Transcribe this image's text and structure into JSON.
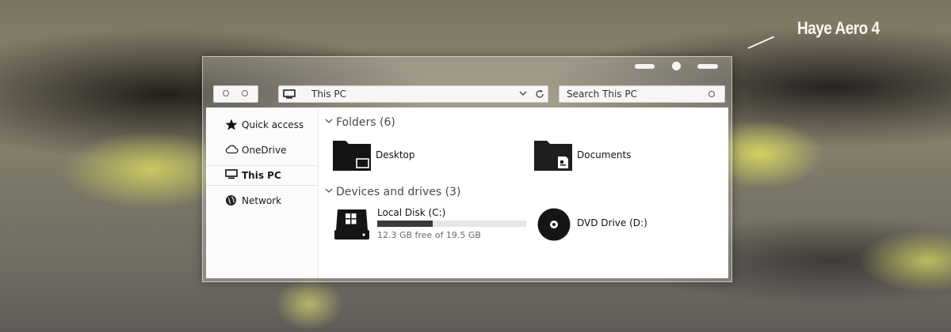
{
  "wallpaper": {
    "label": "Haye Aero 4"
  },
  "address_bar": {
    "path": "This PC"
  },
  "search": {
    "placeholder": "Search This PC"
  },
  "nav_pane": {
    "items": [
      {
        "label": "Quick access",
        "icon": "star-icon"
      },
      {
        "label": "OneDrive",
        "icon": "cloud-icon"
      },
      {
        "label": "This PC",
        "icon": "computer-icon",
        "selected": true
      },
      {
        "label": "Network",
        "icon": "network-icon"
      }
    ]
  },
  "content": {
    "folders_header": "Folders (6)",
    "folders": [
      {
        "name": "Desktop",
        "icon": "desktop-folder-icon"
      },
      {
        "name": "Documents",
        "icon": "documents-folder-icon"
      }
    ],
    "devices_header": "Devices and drives (3)",
    "drives": [
      {
        "name": "Local Disk (C:)",
        "free_text": "12.3 GB free of 19.5 GB",
        "used_fraction": 0.37,
        "icon": "hard-drive-icon"
      },
      {
        "name": "DVD Drive (D:)",
        "icon": "dvd-drive-icon"
      }
    ]
  },
  "colors": {
    "accent_dark": "#111111",
    "drive_bar_fill": "#3a3a3a",
    "pane_bg": "#ffffff"
  }
}
